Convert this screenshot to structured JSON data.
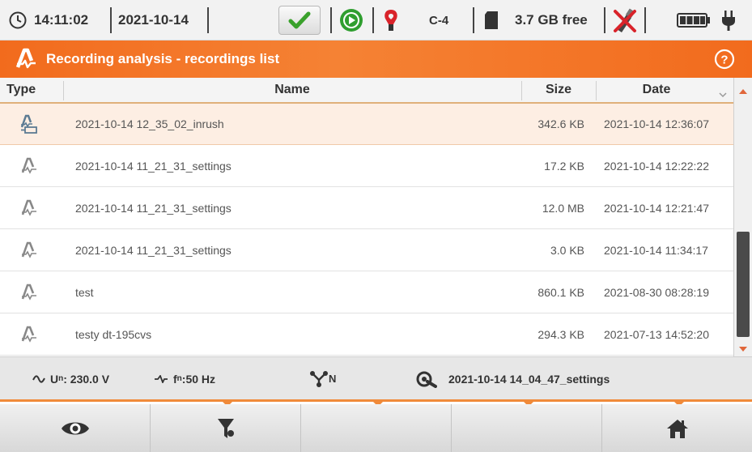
{
  "status": {
    "time": "14:11:02",
    "date": "2021-10-14",
    "clamp": "C-4",
    "storage": "3.7 GB free"
  },
  "title": "Recording analysis - recordings list",
  "table": {
    "headers": {
      "type": "Type",
      "name": "Name",
      "size": "Size",
      "date": "Date"
    },
    "rows": [
      {
        "name": "2021-10-14 12_35_02_inrush",
        "size": "342.6 KB",
        "date": "2021-10-14 12:36:07",
        "icon": "inrush-recording-icon",
        "selected": true
      },
      {
        "name": "2021-10-14 11_21_31_settings",
        "size": "17.2 KB",
        "date": "2021-10-14 12:22:22",
        "icon": "recording-icon"
      },
      {
        "name": "2021-10-14 11_21_31_settings",
        "size": "12.0 MB",
        "date": "2021-10-14 12:21:47",
        "icon": "recording-icon"
      },
      {
        "name": "2021-10-14 11_21_31_settings",
        "size": "3.0 KB",
        "date": "2021-10-14 11:34:17",
        "icon": "recording-icon"
      },
      {
        "name": "test",
        "size": "860.1 KB",
        "date": "2021-08-30 08:28:19",
        "icon": "recording-icon"
      },
      {
        "name": "testy dt-195cvs",
        "size": "294.3 KB",
        "date": "2021-07-13 14:52:20",
        "icon": "recording-icon"
      }
    ]
  },
  "info": {
    "un_label": "U",
    "un_sub": "n",
    "un_value": ": 230.0 V",
    "fn_label": "f",
    "fn_sub": "n",
    "fn_value": ":50 Hz",
    "net_sub": "N",
    "settings_file": "2021-10-14 14_04_47_settings"
  },
  "colors": {
    "accent": "#f26b1d",
    "selected_row": "#fdeee3",
    "status_ok": "#3aa12c"
  },
  "buttons": [
    "eye-icon",
    "filter-icon",
    "",
    "",
    "home-icon"
  ]
}
